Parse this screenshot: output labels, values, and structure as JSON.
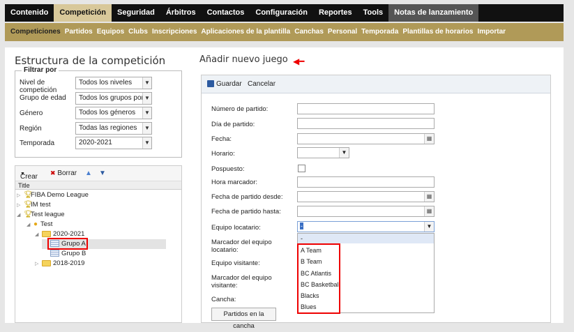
{
  "top_nav": {
    "items": [
      "Contenido",
      "Competición",
      "Seguridad",
      "Árbitros",
      "Contactos",
      "Configuración",
      "Reportes",
      "Tools",
      "Notas de lanzamiento"
    ]
  },
  "sub_nav": {
    "items": [
      "Competiciones",
      "Partidos",
      "Equipos",
      "Clubs",
      "Inscripciones",
      "Aplicaciones de la plantilla",
      "Canchas",
      "Personal",
      "Temporada",
      "Plantillas de horarios",
      "Importar"
    ]
  },
  "left_panel": {
    "title": "Estructura de la competición",
    "filter": {
      "legend": "Filtrar por",
      "fields": [
        {
          "label": "Nivel de competición",
          "value": "Todos los niveles"
        },
        {
          "label": "Grupo de edad",
          "value": "Todos los grupos por"
        },
        {
          "label": "Género",
          "value": "Todos los géneros"
        },
        {
          "label": "Región",
          "value": "Todas las regiones"
        },
        {
          "label": "Temporada",
          "value": "2020-2021"
        }
      ]
    },
    "tree": {
      "toolbar": {
        "create": "Crear",
        "delete": "Borrar"
      },
      "column_header": "Title",
      "nodes": [
        "FIBA Demo League",
        "IM test",
        "Test league",
        "Test",
        "2020-2021",
        "Grupo A",
        "Grupo B",
        "2018-2019"
      ]
    }
  },
  "right_panel": {
    "title": "Añadir nuevo juego",
    "toolbar": {
      "save": "Guardar",
      "cancel": "Cancelar"
    },
    "fields": {
      "match_number": "Número de partido:",
      "match_day": "Día de partido:",
      "date": "Fecha:",
      "time": "Horario:",
      "postponed": "Pospuesto:",
      "score_time": "Hora marcador:",
      "date_from": "Fecha de partido desde:",
      "date_to": "Fecha de partido hasta:",
      "home_team": "Equipo locatario:",
      "home_score": "Marcador del equipo locatario:",
      "away_team": "Equipo visitante:",
      "away_score": "Marcador del equipo visitante:",
      "court": "Cancha:"
    },
    "home_team_value": "-",
    "dropdown_options": [
      "-",
      "A Team",
      "B Team",
      "BC Atlantis",
      "BC Basketball",
      "Blacks",
      "Blues"
    ],
    "pitches_button": "Partidos en la cancha"
  },
  "colors": {
    "top_active": "#d8c89a",
    "subbar": "#b09a58",
    "annotation": "#e00000"
  }
}
